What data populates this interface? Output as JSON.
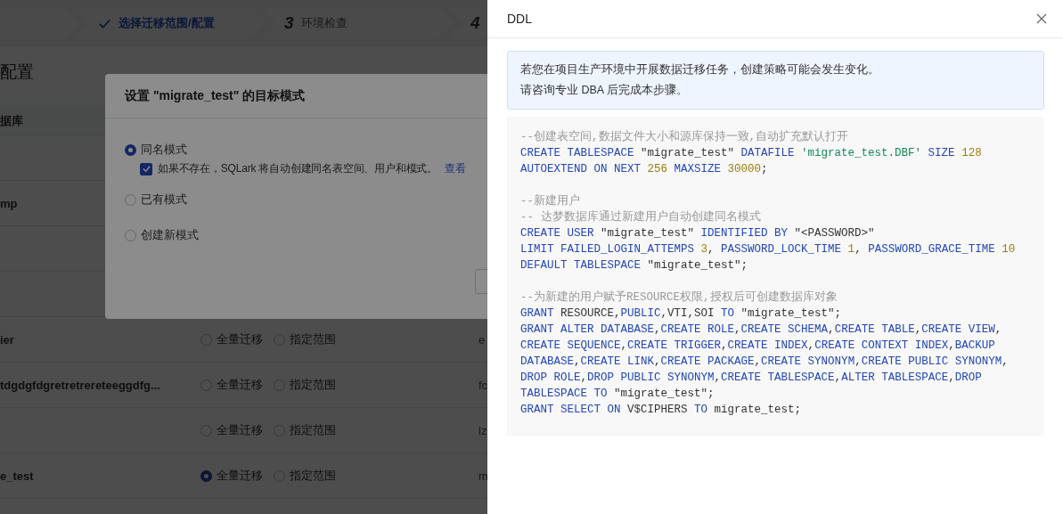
{
  "steps": [
    {
      "kind": "done",
      "label": "选择迁移范围/配置"
    },
    {
      "kind": "pending",
      "number": "3",
      "label": "环境检查"
    },
    {
      "kind": "pending",
      "number": "4"
    }
  ],
  "page": {
    "heading": "配置",
    "table_header": "据库",
    "rows": [
      {
        "kind": "blank"
      },
      {
        "kind": "row",
        "name": "mp"
      },
      {
        "kind": "blank"
      },
      {
        "kind": "blank"
      },
      {
        "kind": "row",
        "name": "ier",
        "options": [
          {
            "label": "全量迁移",
            "selected": false
          },
          {
            "label": "指定范围",
            "selected": false
          }
        ],
        "column_3": "e"
      },
      {
        "kind": "row",
        "name": "tdgdgfdgretretrereteeggdfg...",
        "options": [
          {
            "label": "全量迁移",
            "selected": false
          },
          {
            "label": "指定范围",
            "selected": false
          }
        ],
        "column_3": "fc"
      },
      {
        "kind": "row",
        "options": [
          {
            "label": "全量迁移",
            "selected": false
          },
          {
            "label": "指定范围",
            "selected": false
          }
        ],
        "column_3": "lz"
      },
      {
        "kind": "row",
        "name": "e_test",
        "options": [
          {
            "label": "全量迁移",
            "selected": true
          },
          {
            "label": "指定范围",
            "selected": false
          }
        ],
        "column_3": "m"
      }
    ]
  },
  "dialog": {
    "title": "设置 \"migrate_test\" 的目标模式",
    "modes": [
      {
        "label": "同名模式",
        "selected": true
      },
      {
        "label": "已有模式",
        "selected": false
      },
      {
        "label": "创建新模式",
        "selected": false
      }
    ],
    "auto_create": {
      "label": "如果不存在，SQLark 将自动创建同名表空间、用户和模式。",
      "checked": true,
      "link": "查看"
    }
  },
  "drawer": {
    "title": "DDL",
    "notice": [
      "若您在项目生产环境中开展数据迁移任务，创建策略可能会发生变化。",
      "请咨询专业 DBA 后完成本步骤。"
    ],
    "blocks": [
      {
        "lines": [
          [
            {
              "kind": "comment",
              "text": "--创建表空间,数据文件大小和源库保持一致,自动扩充默认打开"
            }
          ],
          [
            {
              "kind": "keyword",
              "text": "CREATE TABLESPACE "
            },
            {
              "kind": "plain",
              "text": "\"migrate_test\" "
            },
            {
              "kind": "keyword",
              "text": "DATAFILE "
            },
            {
              "kind": "string",
              "text": "'migrate_test.DBF'"
            },
            {
              "kind": "keyword",
              "text": " SIZE "
            },
            {
              "kind": "number",
              "text": "128"
            }
          ],
          [
            {
              "kind": "keyword",
              "text": "AUTOEXTEND ON NEXT "
            },
            {
              "kind": "number",
              "text": "256"
            },
            {
              "kind": "keyword",
              "text": " MAXSIZE "
            },
            {
              "kind": "number",
              "text": "30000"
            },
            {
              "kind": "plain",
              "text": ";"
            }
          ]
        ]
      },
      {
        "lines": [
          [
            {
              "kind": "comment",
              "text": "--新建用户"
            }
          ],
          [
            {
              "kind": "comment",
              "text": "-- 达梦数据库通过新建用户自动创建同名模式"
            }
          ],
          [
            {
              "kind": "keyword",
              "text": "CREATE USER "
            },
            {
              "kind": "plain",
              "text": "\"migrate_test\" "
            },
            {
              "kind": "keyword",
              "text": "IDENTIFIED BY "
            },
            {
              "kind": "plain",
              "text": "\"<PASSWORD>\""
            }
          ],
          [
            {
              "kind": "keyword",
              "text": "LIMIT FAILED_LOGIN_ATTEMPS "
            },
            {
              "kind": "number",
              "text": "3"
            },
            {
              "kind": "plain",
              "text": ", "
            },
            {
              "kind": "keyword",
              "text": "PASSWORD_LOCK_TIME "
            },
            {
              "kind": "number",
              "text": "1"
            },
            {
              "kind": "plain",
              "text": ", "
            },
            {
              "kind": "keyword",
              "text": "PASSWORD_GRACE_TIME "
            },
            {
              "kind": "number",
              "text": "10"
            }
          ],
          [
            {
              "kind": "keyword",
              "text": "DEFAULT TABLESPACE "
            },
            {
              "kind": "plain",
              "text": "\"migrate_test\";"
            }
          ]
        ]
      },
      {
        "lines": [
          [
            {
              "kind": "comment",
              "text": "--为新建的用户赋予RESOURCE权限,授权后可创建数据库对象"
            }
          ],
          [
            {
              "kind": "keyword",
              "text": "GRANT "
            },
            {
              "kind": "plain",
              "text": "RESOURCE,"
            },
            {
              "kind": "keyword",
              "text": "PUBLIC"
            },
            {
              "kind": "plain",
              "text": ",VTI,SOI "
            },
            {
              "kind": "keyword",
              "text": "TO "
            },
            {
              "kind": "plain",
              "text": "\"migrate_test\";"
            }
          ],
          [
            {
              "kind": "keyword",
              "text": "GRANT ALTER DATABASE"
            },
            {
              "kind": "plain",
              "text": ","
            },
            {
              "kind": "keyword",
              "text": "CREATE ROLE"
            },
            {
              "kind": "plain",
              "text": ","
            },
            {
              "kind": "keyword",
              "text": "CREATE SCHEMA"
            },
            {
              "kind": "plain",
              "text": ","
            },
            {
              "kind": "keyword",
              "text": "CREATE TABLE"
            },
            {
              "kind": "plain",
              "text": ","
            },
            {
              "kind": "keyword",
              "text": "CREATE VIEW"
            },
            {
              "kind": "plain",
              "text": ","
            }
          ],
          [
            {
              "kind": "keyword",
              "text": "CREATE SEQUENCE"
            },
            {
              "kind": "plain",
              "text": ","
            },
            {
              "kind": "keyword",
              "text": "CREATE TRIGGER"
            },
            {
              "kind": "plain",
              "text": ","
            },
            {
              "kind": "keyword",
              "text": "CREATE INDEX"
            },
            {
              "kind": "plain",
              "text": ","
            },
            {
              "kind": "keyword",
              "text": "CREATE CONTEXT INDEX"
            },
            {
              "kind": "plain",
              "text": ","
            },
            {
              "kind": "keyword",
              "text": "BACKUP"
            }
          ],
          [
            {
              "kind": "keyword",
              "text": "DATABASE"
            },
            {
              "kind": "plain",
              "text": ","
            },
            {
              "kind": "keyword",
              "text": "CREATE LINK"
            },
            {
              "kind": "plain",
              "text": ","
            },
            {
              "kind": "keyword",
              "text": "CREATE PACKAGE"
            },
            {
              "kind": "plain",
              "text": ","
            },
            {
              "kind": "keyword",
              "text": "CREATE SYNONYM"
            },
            {
              "kind": "plain",
              "text": ","
            },
            {
              "kind": "keyword",
              "text": "CREATE PUBLIC SYNONYM"
            },
            {
              "kind": "plain",
              "text": ","
            }
          ],
          [
            {
              "kind": "keyword",
              "text": "DROP ROLE"
            },
            {
              "kind": "plain",
              "text": ","
            },
            {
              "kind": "keyword",
              "text": "DROP PUBLIC SYNONYM"
            },
            {
              "kind": "plain",
              "text": ","
            },
            {
              "kind": "keyword",
              "text": "CREATE TABLESPACE"
            },
            {
              "kind": "plain",
              "text": ","
            },
            {
              "kind": "keyword",
              "text": "ALTER TABLESPACE"
            },
            {
              "kind": "plain",
              "text": ","
            },
            {
              "kind": "keyword",
              "text": "DROP"
            }
          ],
          [
            {
              "kind": "keyword",
              "text": "TABLESPACE TO "
            },
            {
              "kind": "plain",
              "text": "\"migrate_test\";"
            }
          ],
          [
            {
              "kind": "keyword",
              "text": "GRANT SELECT ON "
            },
            {
              "kind": "plain",
              "text": "V$CIPHERS "
            },
            {
              "kind": "keyword",
              "text": "TO "
            },
            {
              "kind": "plain",
              "text": "migrate_test;"
            }
          ]
        ]
      }
    ]
  }
}
